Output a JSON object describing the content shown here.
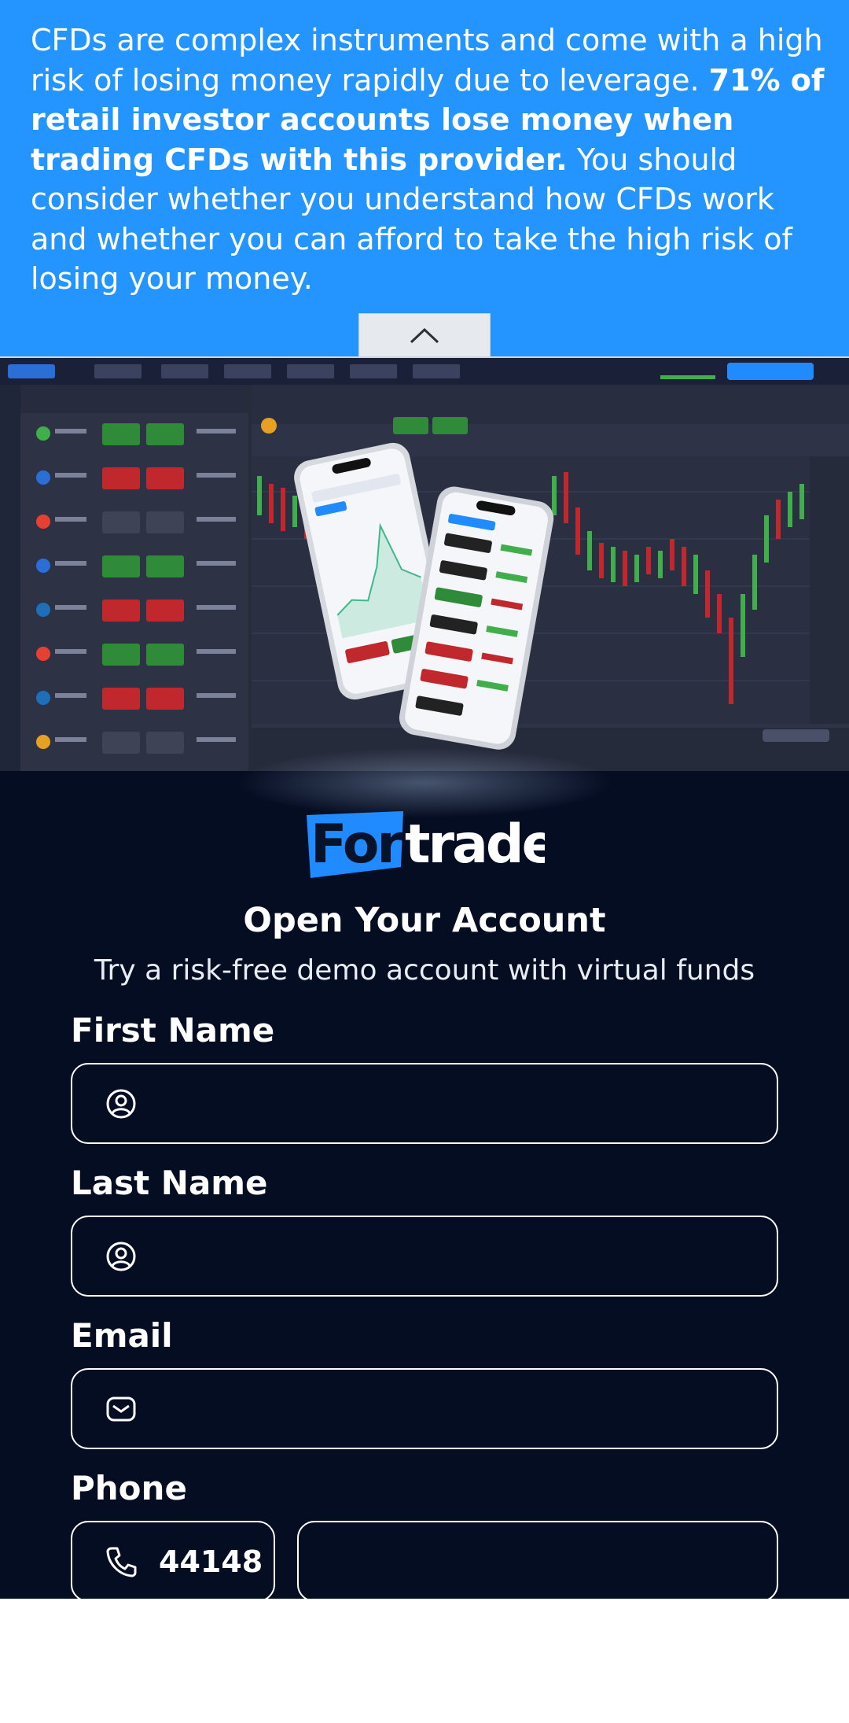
{
  "risk_warning": {
    "text_before": "CFDs are complex instruments and come with a high risk of losing money rapidly due to leverage. ",
    "text_bold": "71% of retail investor accounts lose money when trading CFDs with this provider.",
    "text_after": " You should consider whether you understand how CFDs work and whether you can afford to take the high risk of losing your money.",
    "collapse_icon": "chevron-up-icon"
  },
  "brand": {
    "logo_text_a": "For",
    "logo_text_b": "trade",
    "accent_color": "#2495ff",
    "background_color": "#050d22"
  },
  "form": {
    "title": "Open Your Account",
    "subtitle": "Try a risk-free demo account with virtual funds",
    "first_name": {
      "label": "First Name",
      "value": "",
      "placeholder": "",
      "icon": "user-icon"
    },
    "last_name": {
      "label": "Last Name",
      "value": "",
      "placeholder": "",
      "icon": "user-icon"
    },
    "email": {
      "label": "Email",
      "value": "",
      "placeholder": "",
      "icon": "mail-icon"
    },
    "phone": {
      "label": "Phone",
      "country_code": "44148",
      "number": "",
      "placeholder": "",
      "icon": "phone-icon"
    }
  }
}
